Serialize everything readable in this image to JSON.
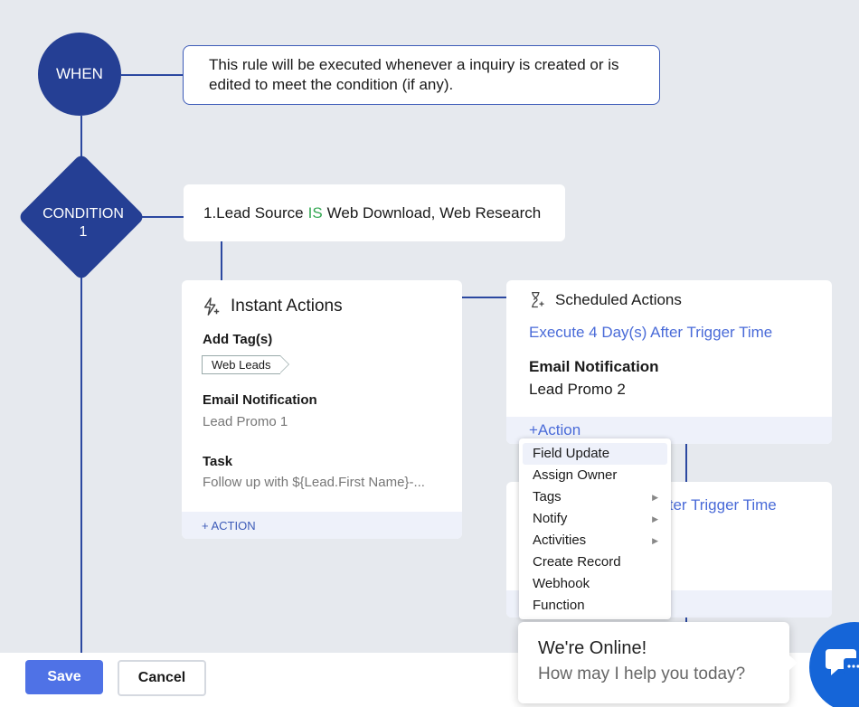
{
  "when": {
    "node_label": "WHEN",
    "description": "This rule will be executed whenever a inquiry is created or is edited to meet the condition (if any)."
  },
  "condition": {
    "node_line1": "CONDITION",
    "node_line2": "1",
    "field": "1.Lead Source",
    "operator": "IS",
    "value": "Web Download, Web Research"
  },
  "instant_actions": {
    "title": "Instant Actions",
    "add_tags_label": "Add Tag(s)",
    "tag": "Web Leads",
    "email_label": "Email Notification",
    "email_value": "Lead Promo 1",
    "task_label": "Task",
    "task_value": "Follow up with ${Lead.First Name}-...",
    "footer": "+ ACTION"
  },
  "scheduled_actions": {
    "title": "Scheduled Actions",
    "schedule": "Execute 4 Day(s) After Trigger Time",
    "email_label": "Email Notification",
    "email_value": "Lead Promo 2",
    "footer": "+Action"
  },
  "scheduled_actions_2": {
    "schedule_partial": "fter Trigger Time"
  },
  "action_menu": {
    "items": [
      {
        "label": "Field Update",
        "submenu": false
      },
      {
        "label": "Assign Owner",
        "submenu": false
      },
      {
        "label": "Tags",
        "submenu": true
      },
      {
        "label": "Notify",
        "submenu": true
      },
      {
        "label": "Activities",
        "submenu": true
      },
      {
        "label": "Create Record",
        "submenu": false
      },
      {
        "label": "Webhook",
        "submenu": false
      },
      {
        "label": "Function",
        "submenu": false
      }
    ]
  },
  "buttons": {
    "save": "Save",
    "cancel": "Cancel"
  },
  "chat": {
    "title": "We're Online!",
    "subtitle": "How may I help you today?"
  },
  "colors": {
    "node": "#253f94",
    "accent": "#4f72e6",
    "link": "#4a6bd8",
    "operator": "#34a853"
  }
}
